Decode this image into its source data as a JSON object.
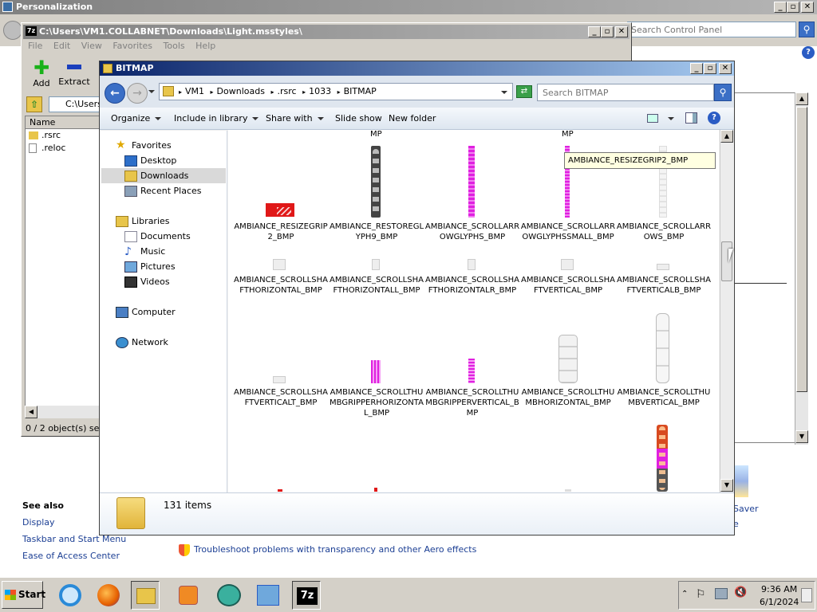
{
  "personalization": {
    "title": "Personalization",
    "search_placeholder": "Search Control Panel",
    "see_also_heading": "See also",
    "see_also_links": [
      "Display",
      "Taskbar and Start Menu",
      "Ease of Access Center"
    ],
    "troubleshoot_link": "Troubleshoot problems with transparency and other Aero effects",
    "partial_saver": "Saver",
    "partial_e": "e"
  },
  "sevenzip": {
    "title": "C:\\Users\\VM1.COLLABNET\\Downloads\\Light.msstyles\\",
    "menu": [
      "File",
      "Edit",
      "View",
      "Favorites",
      "Tools",
      "Help"
    ],
    "tool_add": "Add",
    "tool_extract": "Extract",
    "path": "C:\\Users",
    "column_name": "Name",
    "rows": [
      ".rsrc",
      ".reloc"
    ],
    "status": "0 / 2 object(s) selec"
  },
  "explorer": {
    "title": "BITMAP",
    "breadcrumb": [
      "VM1",
      "Downloads",
      ".rsrc",
      "1033",
      "BITMAP"
    ],
    "search_placeholder": "Search BITMAP",
    "toolbar": {
      "organize": "Organize",
      "include": "Include in library",
      "share": "Share with",
      "slideshow": "Slide show",
      "newfolder": "New folder"
    },
    "nav": {
      "favorites": "Favorites",
      "desktop": "Desktop",
      "downloads": "Downloads",
      "recent": "Recent Places",
      "libraries": "Libraries",
      "documents": "Documents",
      "music": "Music",
      "pictures": "Pictures",
      "videos": "Videos",
      "computer": "Computer",
      "network": "Network"
    },
    "top_partial": [
      "MP",
      "MP"
    ],
    "files_row1": [
      "AMBIANCE_RESIZEGRIP2_BMP",
      "AMBIANCE_RESTOREGLYPH9_BMP",
      "AMBIANCE_SCROLLARROWGLYPHS_BMP",
      "AMBIANCE_SCROLLARROWGLYPHSSMALL_BMP",
      "AMBIANCE_SCROLLARROWS_BMP"
    ],
    "files_row2": [
      "AMBIANCE_SCROLLSHAFTHORIZONTAL_BMP",
      "AMBIANCE_SCROLLSHAFTHORIZONTALL_BMP",
      "AMBIANCE_SCROLLSHAFTHORIZONTALR_BMP",
      "AMBIANCE_SCROLLSHAFTVERTICAL_BMP",
      "AMBIANCE_SCROLLSHAFTVERTICALB_BMP"
    ],
    "files_row3": [
      "AMBIANCE_SCROLLSHAFTVERTICALT_BMP",
      "AMBIANCE_SCROLLTHUMBGRIPPERHORIZONTAL_BMP",
      "AMBIANCE_SCROLLTHUMBGRIPPERVERTICAL_BMP",
      "AMBIANCE_SCROLLTHUMBHORIZONTAL_BMP",
      "AMBIANCE_SCROLLTHUMBVERTICAL_BMP"
    ],
    "tooltip": "AMBIANCE_RESIZEGRIP2_BMP",
    "item_count": "131 items"
  },
  "taskbar": {
    "start": "Start",
    "time": "9:36 AM",
    "date": "6/1/2024"
  },
  "colors": {
    "accent_magenta": "#e020e0",
    "resize_red": "#e01818",
    "link_blue": "#1c3f94"
  }
}
